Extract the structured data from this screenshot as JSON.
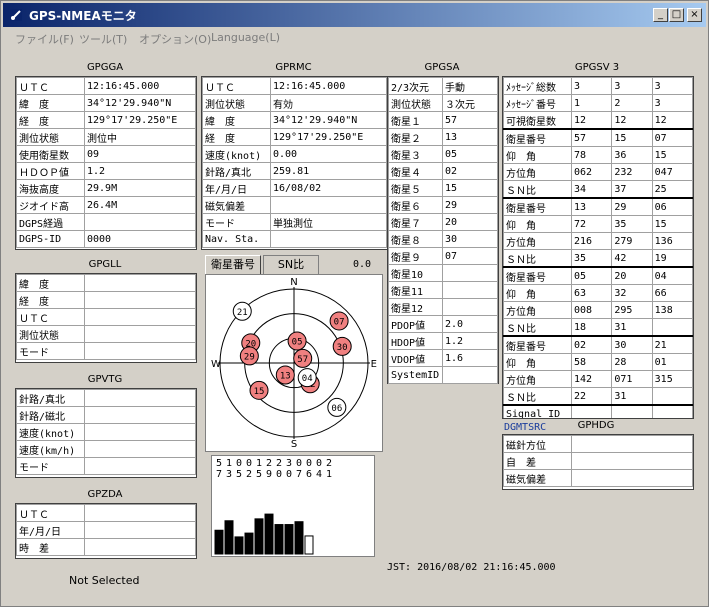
{
  "window": {
    "title": "GPS-NMEAモニタ",
    "minimize": "_",
    "maximize": "□",
    "close": "×"
  },
  "menu": [
    "ファイル(F)",
    "ツール(T)",
    "オプション(O)",
    "Language(L)"
  ],
  "gpgga": {
    "title": "GPGGA",
    "rows": [
      [
        "ＵＴＣ",
        "12:16:45.000"
      ],
      [
        "緯　度",
        " 34°12'29.940\"N"
      ],
      [
        "経　度",
        "129°17'29.250\"E"
      ],
      [
        "測位状態",
        "測位中"
      ],
      [
        "使用衛星数",
        "09"
      ],
      [
        "ＨＤＯＰ値",
        "1.2"
      ],
      [
        "海抜高度",
        "29.9M"
      ],
      [
        "ジオイド高",
        "26.4M"
      ],
      [
        "DGPS経過",
        ""
      ],
      [
        "DGPS-ID",
        "0000"
      ]
    ]
  },
  "gprmc": {
    "title": "GPRMC",
    "rows": [
      [
        "ＵＴＣ",
        "12:16:45.000"
      ],
      [
        "測位状態",
        "有効"
      ],
      [
        "緯　度",
        " 34°12'29.940\"N"
      ],
      [
        "経　度",
        "129°17'29.250\"E"
      ],
      [
        "速度(knot)",
        "0.00"
      ],
      [
        "針路/真北",
        "259.81"
      ],
      [
        "年/月/日",
        "16/08/02"
      ],
      [
        "磁気偏差",
        ""
      ],
      [
        "モード",
        "単独測位"
      ],
      [
        "Nav. Sta.",
        ""
      ]
    ]
  },
  "gpgsa": {
    "title": "GPGSA",
    "rows": [
      [
        "2/3次元",
        "手動"
      ],
      [
        "測位状態",
        "３次元"
      ],
      [
        "衛星１",
        "57"
      ],
      [
        "衛星２",
        "13"
      ],
      [
        "衛星３",
        "05"
      ],
      [
        "衛星４",
        "02"
      ],
      [
        "衛星５",
        "15"
      ],
      [
        "衛星６",
        "29"
      ],
      [
        "衛星７",
        "20"
      ],
      [
        "衛星８",
        "30"
      ],
      [
        "衛星９",
        "07"
      ],
      [
        "衛星10",
        ""
      ],
      [
        "衛星11",
        ""
      ],
      [
        "衛星12",
        ""
      ],
      [
        "PDOP値",
        "2.0"
      ],
      [
        "HDOP値",
        "1.2"
      ],
      [
        "VDOP値",
        "1.6"
      ],
      [
        "SystemID",
        ""
      ]
    ]
  },
  "gpgsv": {
    "title": "GPGSV 3",
    "head": [
      [
        "ﾒｯｾｰｼﾞ総数",
        "3",
        "3",
        "3"
      ],
      [
        "ﾒｯｾｰｼﾞ番号",
        "1",
        "2",
        "3"
      ],
      [
        "可視衛星数",
        "12",
        "12",
        "12"
      ]
    ],
    "groups": [
      [
        [
          "衛星番号",
          "57",
          "15",
          "07"
        ],
        [
          "仰　角",
          "78",
          "36",
          "15"
        ],
        [
          "方位角",
          "062",
          "232",
          "047"
        ],
        [
          "ＳＮ比",
          "34",
          "37",
          "25"
        ]
      ],
      [
        [
          "衛星番号",
          "13",
          "29",
          "06"
        ],
        [
          "仰　角",
          "72",
          "35",
          "15"
        ],
        [
          "方位角",
          "216",
          "279",
          "136"
        ],
        [
          "ＳＮ比",
          "35",
          "42",
          "19"
        ]
      ],
      [
        [
          "衛星番号",
          "05",
          "20",
          "04"
        ],
        [
          "仰　角",
          "63",
          "32",
          "66"
        ],
        [
          "方位角",
          "008",
          "295",
          "138"
        ],
        [
          "ＳＮ比",
          "18",
          "31",
          ""
        ]
      ],
      [
        [
          "衛星番号",
          "02",
          "30",
          "21"
        ],
        [
          "仰　角",
          "58",
          "28",
          "01"
        ],
        [
          "方位角",
          "142",
          "071",
          "315"
        ],
        [
          "ＳＮ比",
          "22",
          "31",
          ""
        ]
      ]
    ],
    "signal": [
      "Signal ID",
      "",
      "",
      ""
    ]
  },
  "gpll": {
    "title": "GPGLL",
    "rows": [
      [
        "緯　度",
        ""
      ],
      [
        "経　度",
        ""
      ],
      [
        "ＵＴＣ",
        ""
      ],
      [
        "測位状態",
        ""
      ],
      [
        "モード",
        ""
      ]
    ]
  },
  "gpvtg": {
    "title": "GPVTG",
    "rows": [
      [
        "針路/真北",
        ""
      ],
      [
        "針路/磁北",
        ""
      ],
      [
        "速度(knot)",
        ""
      ],
      [
        "速度(km/h)",
        ""
      ],
      [
        "モード",
        ""
      ]
    ]
  },
  "gpzda": {
    "title": "GPZDA",
    "rows": [
      [
        "ＵＴＣ",
        ""
      ],
      [
        "年/月/日",
        ""
      ],
      [
        "時　差",
        ""
      ]
    ]
  },
  "gphdg": {
    "title": "GPHDG",
    "dgmtsrc": "DGMTSRC",
    "rows": [
      [
        "磁針方位",
        ""
      ],
      [
        "自　差",
        ""
      ],
      [
        "磁気偏差",
        ""
      ]
    ]
  },
  "tabs": {
    "sat_number": "衛星番号",
    "sn_ratio": "SN比",
    "value": "0.0"
  },
  "skyplot": {
    "labels": {
      "n": "N",
      "s": "S",
      "e": "E",
      "w": "W"
    },
    "sats": [
      {
        "id": "21",
        "el": 1,
        "az": 315,
        "used": false
      },
      {
        "id": "05",
        "el": 63,
        "az": 8,
        "used": true
      },
      {
        "id": "07",
        "el": 15,
        "az": 47,
        "used": true
      },
      {
        "id": "30",
        "el": 28,
        "az": 71,
        "used": true
      },
      {
        "id": "20",
        "el": 32,
        "az": 295,
        "used": true
      },
      {
        "id": "29",
        "el": 35,
        "az": 279,
        "used": true
      },
      {
        "id": "57",
        "el": 78,
        "az": 62,
        "used": true
      },
      {
        "id": "02",
        "el": 58,
        "az": 142,
        "used": true
      },
      {
        "id": "13",
        "el": 72,
        "az": 216,
        "used": true
      },
      {
        "id": "04",
        "el": 66,
        "az": 138,
        "used": false
      },
      {
        "id": "15",
        "el": 36,
        "az": 232,
        "used": true
      },
      {
        "id": "06",
        "el": 15,
        "az": 136,
        "used": false
      }
    ],
    "used_color": "#f08080",
    "unused_color": "#ffffff"
  },
  "snbars": {
    "ids_top": [
      "5",
      "1",
      "0",
      "0",
      "1",
      "2",
      "2",
      "3",
      "0",
      "0",
      "0",
      "2"
    ],
    "ids_bottom": [
      "7",
      "3",
      "5",
      "2",
      "5",
      "9",
      "0",
      "0",
      "7",
      "6",
      "4",
      "1"
    ],
    "values": [
      25,
      35,
      18,
      22,
      37,
      42,
      31,
      31,
      34,
      19,
      0,
      0
    ],
    "used": [
      true,
      true,
      true,
      true,
      true,
      true,
      true,
      true,
      true,
      false,
      false,
      false
    ]
  },
  "status": {
    "left": "Not Selected",
    "jst": "JST: 2016/08/02 21:16:45.000"
  }
}
